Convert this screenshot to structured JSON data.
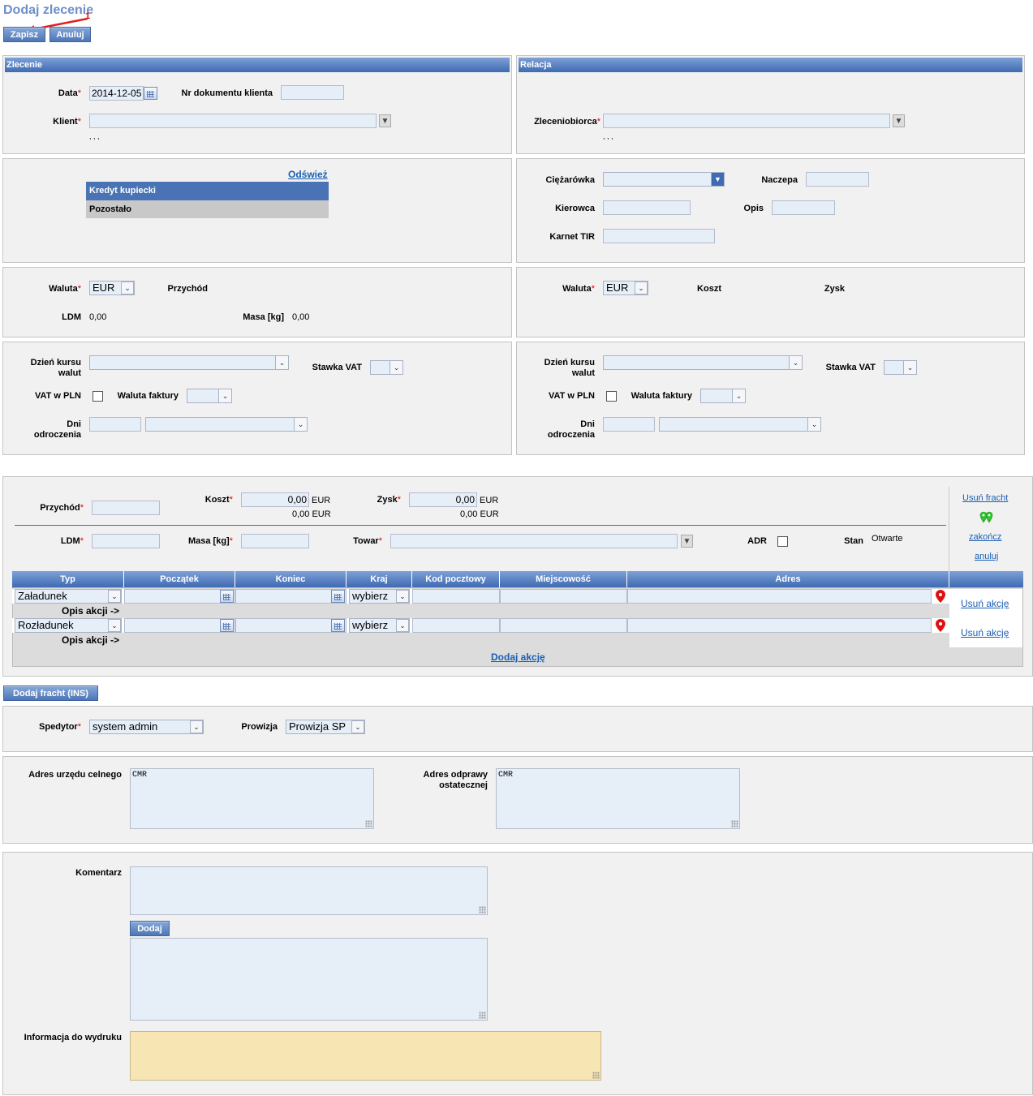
{
  "page": {
    "title": "Dodaj zlecenie",
    "annotation_number": "1"
  },
  "toolbar": {
    "save_label": "Zapisz",
    "cancel_label": "Anuluj"
  },
  "zlecenie": {
    "header": "Zlecenie",
    "date_label": "Data",
    "date_value": "2014-12-05",
    "doc_label": "Nr dokumentu klienta",
    "client_label": "Klient",
    "client_sub": ", , ,"
  },
  "relacja": {
    "header": "Relacja",
    "contractor_label": "Zleceniobiorca",
    "contractor_sub": ", , ,"
  },
  "credit": {
    "refresh": "Odśwież",
    "tab_active": "Kredyt kupiecki",
    "tab_other": "Pozostało"
  },
  "vehicle": {
    "truck_label": "Ciężarówka",
    "trailer_label": "Naczepa",
    "driver_label": "Kierowca",
    "desc_label": "Opis",
    "tir_label": "Karnet TIR"
  },
  "left_currency": {
    "currency_label": "Waluta",
    "currency_value": "EUR",
    "income_label": "Przychód",
    "ldm_label": "LDM",
    "ldm_value": "0,00",
    "mass_label": "Masa [kg]",
    "mass_value": "0,00"
  },
  "right_currency": {
    "currency_label": "Waluta",
    "currency_value": "EUR",
    "cost_label": "Koszt",
    "profit_label": "Zysk"
  },
  "left_vat": {
    "rate_day_label_1": "Dzień kursu",
    "rate_day_label_2": "walut",
    "vat_rate_label": "Stawka VAT",
    "vat_pln_label": "VAT w PLN",
    "invoice_currency_label": "Waluta faktury",
    "days_label_1": "Dni",
    "days_label_2": "odroczenia"
  },
  "right_vat": {
    "rate_day_label_1": "Dzień kursu",
    "rate_day_label_2": "walut",
    "vat_rate_label": "Stawka VAT",
    "vat_pln_label": "VAT w PLN",
    "invoice_currency_label": "Waluta faktury",
    "days_label_1": "Dni",
    "days_label_2": "odroczenia"
  },
  "freight": {
    "income_label": "Przychód",
    "cost_label": "Koszt",
    "cost_value": "0,00",
    "cost_cur": "EUR",
    "cost_sub": "0,00 EUR",
    "profit_label": "Zysk",
    "profit_value": "0,00",
    "profit_cur": "EUR",
    "profit_sub": "0,00 EUR",
    "ldm_label": "LDM",
    "mass_label": "Masa [kg]",
    "goods_label": "Towar",
    "adr_label": "ADR",
    "status_label": "Stan",
    "status_value": "Otwarte",
    "remove_freight": "Usuń fracht",
    "finish": "zakończ",
    "cancel": "anuluj"
  },
  "actions_table": {
    "columns": [
      "Typ",
      "Początek",
      "Koniec",
      "Kraj",
      "Kod pocztowy",
      "Miejscowość",
      "Adres"
    ],
    "rows": [
      {
        "type": "Załadunek",
        "country": "wybierz",
        "desc": "Opis akcji ->",
        "remove": "Usuń akcję"
      },
      {
        "type": "Rozładunek",
        "country": "wybierz",
        "desc": "Opis akcji ->",
        "remove": "Usuń akcję"
      }
    ],
    "add_action": "Dodaj akcję"
  },
  "add_freight_button": "Dodaj fracht (INS)",
  "forwarder": {
    "label": "Spedytor",
    "value": "system admin",
    "commission_label": "Prowizja",
    "commission_value": "Prowizja SP"
  },
  "customs": {
    "office_label": "Adres urzędu celnego",
    "office_value": "CMR",
    "final_label_1": "Adres odprawy",
    "final_label_2": "ostatecznej",
    "final_value": "CMR"
  },
  "comments": {
    "label": "Komentarz",
    "add_button": "Dodaj",
    "print_label": "Informacja do wydruku"
  },
  "colors": {
    "header_blue": "#3f6bb3",
    "title_blue": "#6d8fc8",
    "link": "#1a5fb4",
    "required": "#dd0000",
    "print_bg": "#f8e5b4"
  }
}
